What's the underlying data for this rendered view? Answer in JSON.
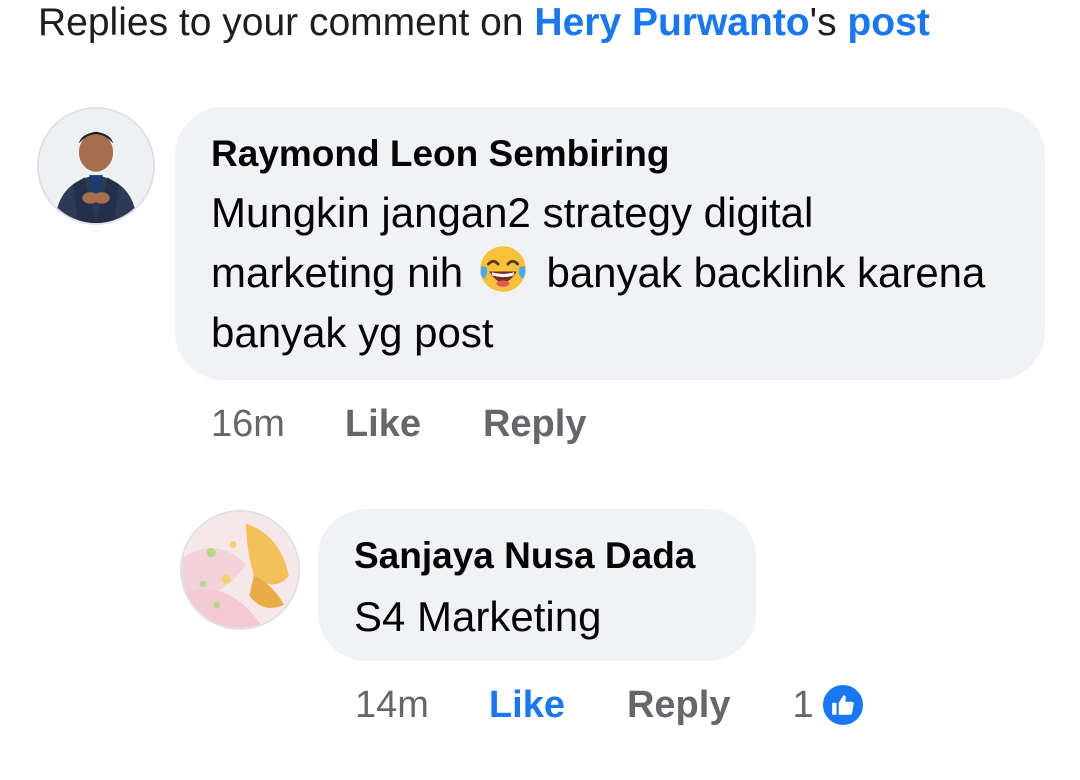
{
  "header": {
    "prefix": "Replies to your comment on ",
    "author_link": "Hery Purwanto",
    "possessive": "'s ",
    "post_link": "post"
  },
  "comments": [
    {
      "author": "Raymond Leon Sembiring",
      "text_parts": [
        "Mungkin jangan2 strategy digital marketing nih",
        "banyak backlink karena banyak yg post"
      ],
      "emoji": "face-with-tears-of-joy-icon",
      "time": "16m",
      "like_label": "Like",
      "reply_label": "Reply"
    },
    {
      "author": "Sanjaya Nusa Dada",
      "text": "S4 Marketing",
      "time": "14m",
      "like_label": "Like",
      "reply_label": "Reply",
      "reaction_count": "1",
      "reaction_icon": "thumbs-up-icon"
    }
  ],
  "colors": {
    "link_blue": "#1877f2",
    "bubble_bg": "#f0f2f5",
    "meta_gray": "#65676b"
  }
}
